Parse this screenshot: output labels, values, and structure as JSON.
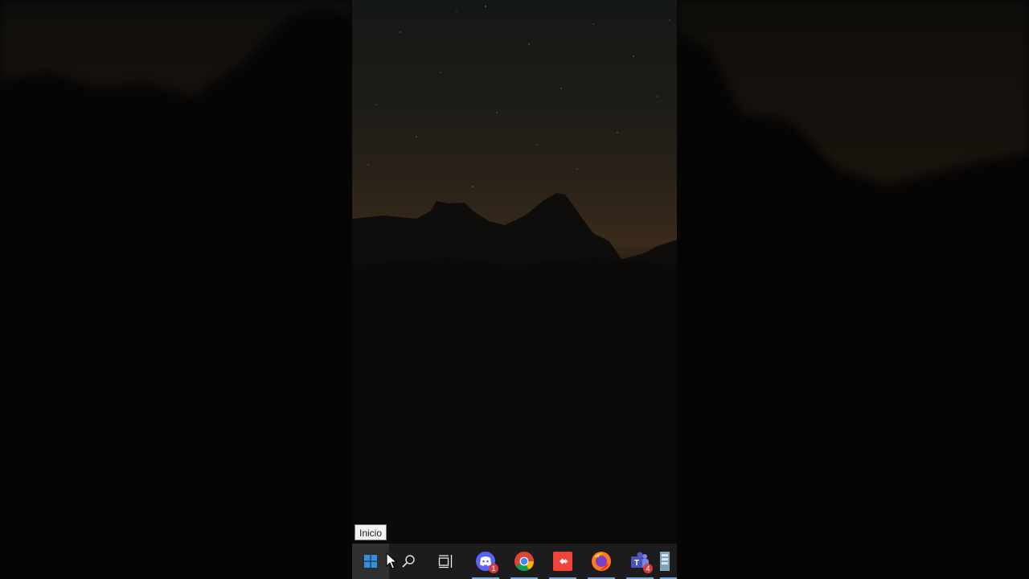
{
  "tooltip": {
    "text": "Inicio"
  },
  "taskbar": {
    "items": [
      {
        "name": "start-button",
        "icon": "windows-logo-icon",
        "badge": ""
      },
      {
        "name": "search-button",
        "icon": "search-icon",
        "badge": ""
      },
      {
        "name": "task-view-button",
        "icon": "task-view-icon",
        "badge": ""
      },
      {
        "name": "discord-app",
        "icon": "discord-icon",
        "badge": "1"
      },
      {
        "name": "chrome-app",
        "icon": "chrome-icon",
        "badge": ""
      },
      {
        "name": "anydesk-app",
        "icon": "anydesk-icon",
        "badge": ""
      },
      {
        "name": "firefox-app",
        "icon": "firefox-icon",
        "badge": ""
      },
      {
        "name": "teams-app",
        "icon": "teams-icon",
        "badge": "4"
      },
      {
        "name": "app-partial",
        "icon": "app-icon",
        "badge": ""
      }
    ]
  },
  "colors": {
    "taskbar_bg": "#1c1c1c",
    "start_hover": "#2f2f2f",
    "windows_blue": "#2f8fe0",
    "active_underline": "#7aa7d6",
    "badge_red": "#d43b3b"
  }
}
